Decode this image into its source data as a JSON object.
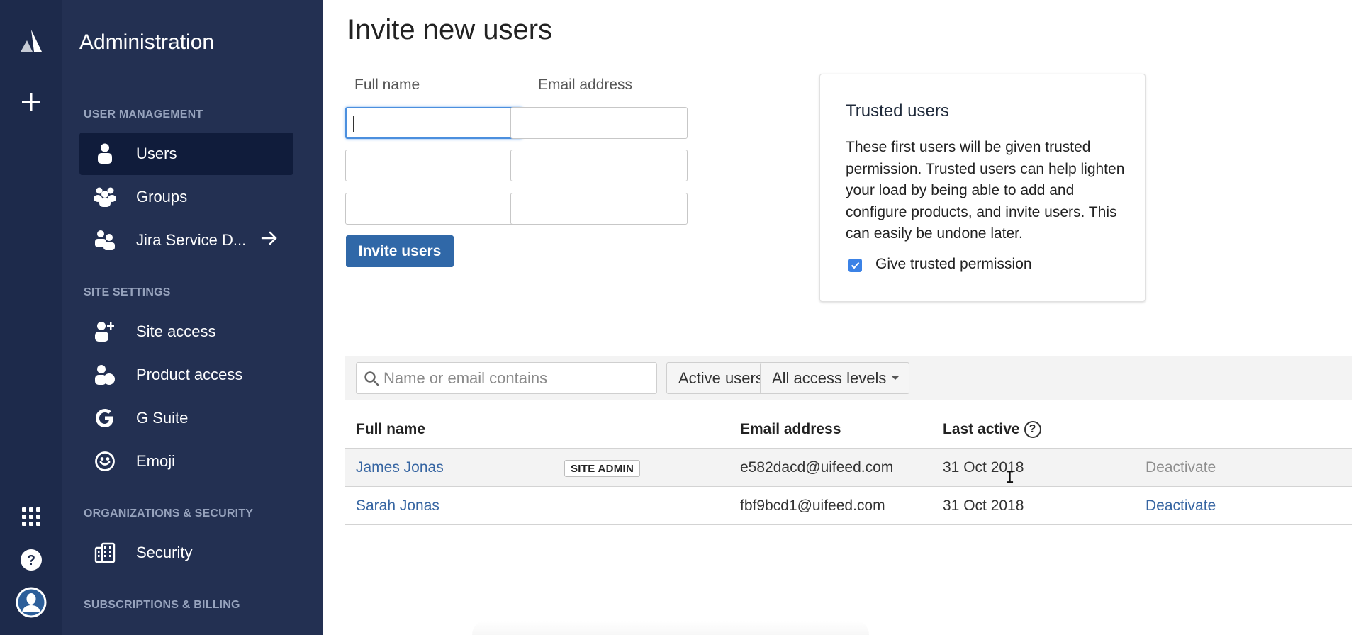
{
  "rail": {
    "logo": "atlassian-logo",
    "create_icon": "plus-icon",
    "apps_icon": "app-switcher-icon",
    "help_icon": "help-icon",
    "avatar_icon": "user-avatar-icon"
  },
  "nav": {
    "title": "Administration",
    "sections": [
      {
        "label": "USER MANAGEMENT",
        "items": [
          {
            "label": "Users",
            "icon": "person-icon",
            "active": true
          },
          {
            "label": "Groups",
            "icon": "people-group-icon"
          },
          {
            "label": "Jira Service D...",
            "icon": "people-icon",
            "external": true
          }
        ]
      },
      {
        "label": "SITE SETTINGS",
        "items": [
          {
            "label": "Site access",
            "icon": "person-add-icon"
          },
          {
            "label": "Product access",
            "icon": "product-access-icon"
          },
          {
            "label": "G Suite",
            "icon": "google-icon"
          },
          {
            "label": "Emoji",
            "icon": "emoji-icon"
          }
        ]
      },
      {
        "label": "ORGANIZATIONS & SECURITY",
        "items": [
          {
            "label": "Security",
            "icon": "office-building-icon"
          }
        ]
      },
      {
        "label": "SUBSCRIPTIONS & BILLING",
        "items": []
      }
    ]
  },
  "invite": {
    "title": "Invite new users",
    "full_name_label": "Full name",
    "email_label": "Email address",
    "rows": [
      {
        "full_name": "",
        "email": ""
      },
      {
        "full_name": "",
        "email": ""
      },
      {
        "full_name": "",
        "email": ""
      }
    ],
    "button_label": "Invite users"
  },
  "trusted": {
    "title": "Trusted users",
    "body": "These first users will be given trusted permission. Trusted users can help lighten your load by being able to add and configure products, and invite users. This can easily be undone later.",
    "checkbox_label": "Give trusted permission",
    "checked": true
  },
  "filters": {
    "search_placeholder": "Name or email contains",
    "search_value": "",
    "status_filter": "Active users",
    "access_filter": "All access levels"
  },
  "table": {
    "columns": [
      "Full name",
      "Email address",
      "Last active"
    ],
    "rows": [
      {
        "name": "James Jonas",
        "badge": "SITE ADMIN",
        "email": "e582dacd@uifeed.com",
        "last_active": "31 Oct 2018",
        "action": "Deactivate",
        "action_enabled": false
      },
      {
        "name": "Sarah Jonas",
        "badge": "",
        "email": "fbf9bcd1@uifeed.com",
        "last_active": "31 Oct 2018",
        "action": "Deactivate",
        "action_enabled": true
      }
    ]
  },
  "colors": {
    "rail_bg": "#1d2a4b",
    "nav_bg": "#233052",
    "nav_active": "#101c3b",
    "primary_button": "#3068a8",
    "link": "#3665a2",
    "checkbox": "#3b82e6"
  }
}
